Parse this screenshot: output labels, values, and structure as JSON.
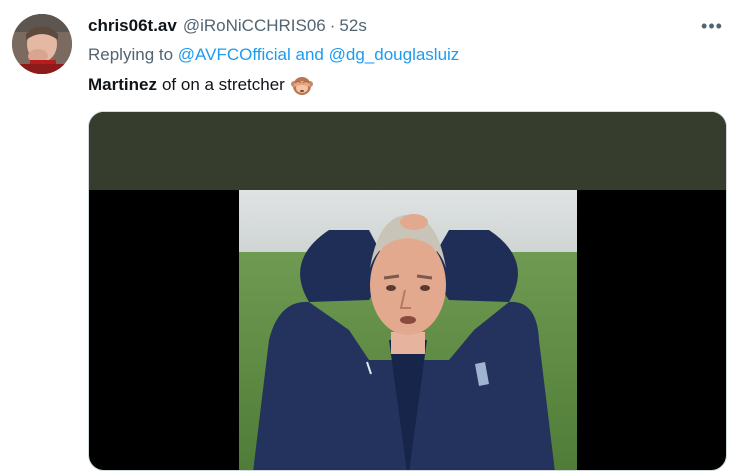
{
  "tweet": {
    "display_name": "chris06t.av",
    "handle": "@iRoNiCCHRIS06",
    "separator": "·",
    "time": "52s",
    "more_label": "•••",
    "reply_prefix": "Replying to",
    "reply_mention_1": "@AVFCOfficial",
    "reply_and": "and",
    "reply_mention_2": "@dg_douglasluiz",
    "text_bold": "Martinez",
    "text_rest": "of on a stretcher",
    "emoji": "see-no-evil-monkey-icon"
  },
  "colors": {
    "link": "#1d9bf0",
    "secondary": "#536471",
    "primary": "#0f1419",
    "media_banner": "#363d2c"
  }
}
